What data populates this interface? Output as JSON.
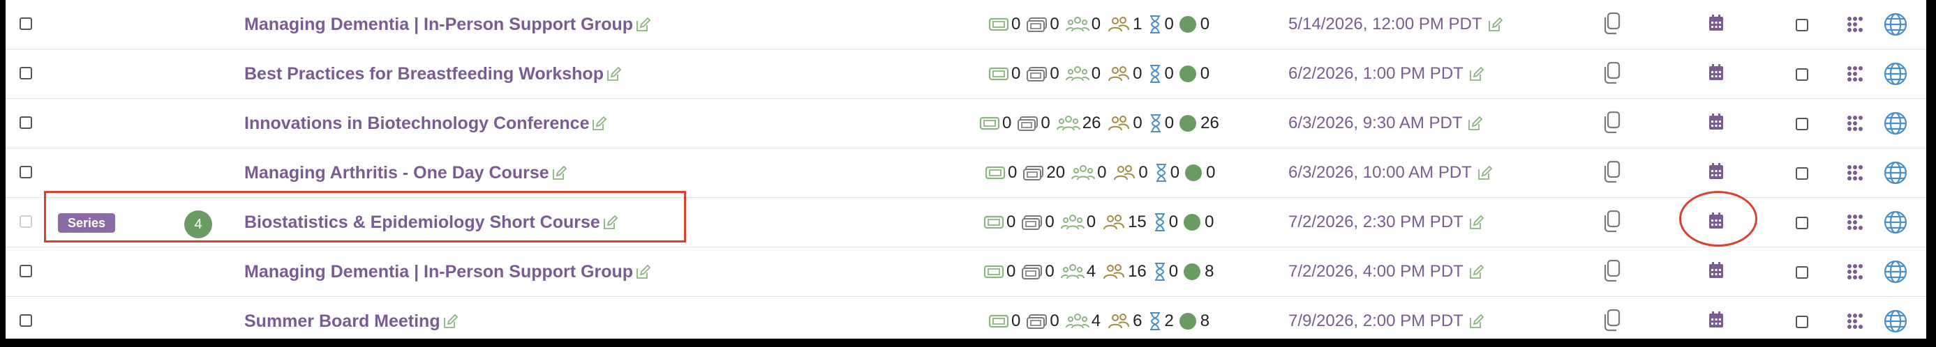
{
  "colors": {
    "title": "#7a5c93",
    "accent_green": "#6a9b62",
    "icon_green": "#8ab57f",
    "icon_blue": "#4a8fc9",
    "highlight": "#d9422f"
  },
  "icons": {
    "stat_1": "ticket-icon",
    "stat_2": "ticket-stack-icon",
    "stat_3": "group-icon",
    "stat_4": "people-icon",
    "stat_5": "hourglass-icon",
    "stat_6": "status-dot-icon",
    "copy": "copy-icon",
    "calendar": "calendar-icon",
    "grid": "grid-icon",
    "globe": "globe-icon",
    "edit": "edit-icon"
  },
  "rows": [
    {
      "title": "Managing Dementia | In-Person Support Group",
      "stats": [
        "0",
        "0",
        "0",
        "1",
        "0",
        "0"
      ],
      "date": "5/14/2026, 12:00 PM PDT"
    },
    {
      "title": "Best Practices for Breastfeeding Workshop",
      "stats": [
        "0",
        "0",
        "0",
        "0",
        "0",
        "0"
      ],
      "date": "6/2/2026, 1:00 PM PDT"
    },
    {
      "title": "Innovations in Biotechnology Conference",
      "stats": [
        "0",
        "0",
        "26",
        "0",
        "0",
        "26"
      ],
      "date": "6/3/2026, 9:30 AM PDT"
    },
    {
      "title": "Managing Arthritis - One Day Course",
      "stats": [
        "0",
        "20",
        "0",
        "0",
        "0",
        "0"
      ],
      "date": "6/3/2026, 10:00 AM PDT"
    },
    {
      "title": "Biostatistics & Epidemiology Short Course",
      "stats": [
        "0",
        "0",
        "0",
        "15",
        "0",
        "0"
      ],
      "date": "7/2/2026, 2:30 PM PDT",
      "series_label": "Series",
      "count": "4"
    },
    {
      "title": "Managing Dementia | In-Person Support Group",
      "stats": [
        "0",
        "0",
        "4",
        "16",
        "0",
        "8"
      ],
      "date": "7/2/2026, 4:00 PM PDT"
    },
    {
      "title": "Summer Board Meeting",
      "stats": [
        "0",
        "0",
        "4",
        "6",
        "2",
        "8"
      ],
      "date": "7/9/2026, 2:00 PM PDT"
    }
  ]
}
